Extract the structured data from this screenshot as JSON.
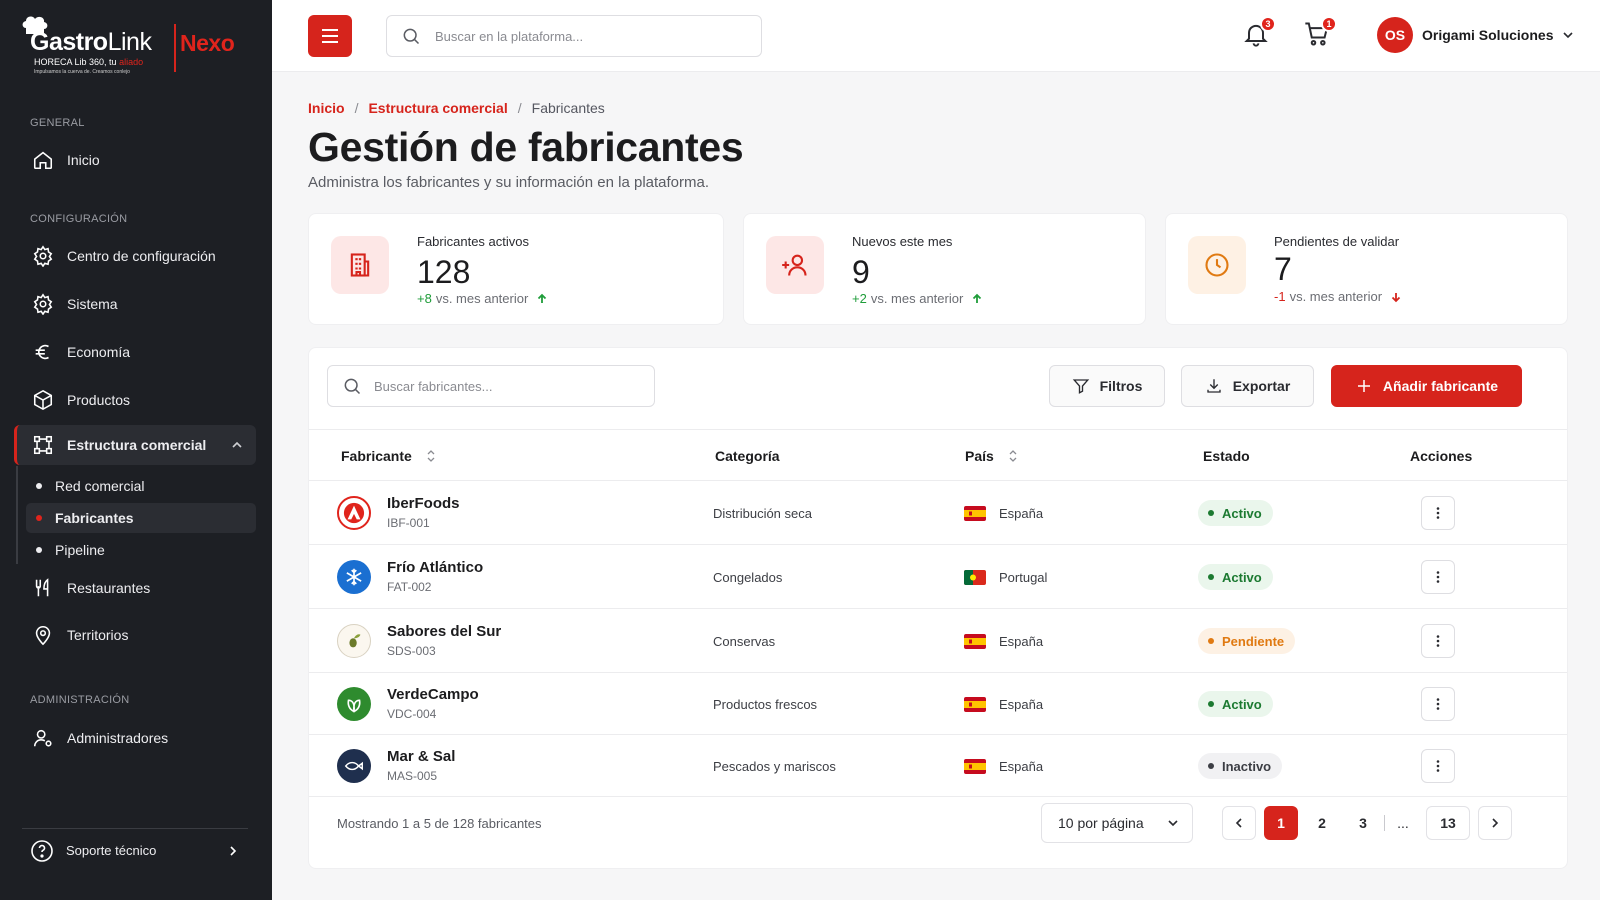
{
  "brand": {
    "name_bold": "Gastro",
    "name_light": "Link",
    "name_accent": "Nexo",
    "tagline": "HORECA Lib 360, tu",
    "tagline_accent": "aliado",
    "tagline_small": "Impulsamos la cuerva de. Creamos conlejo"
  },
  "sidebar": {
    "sections": {
      "general": "GENERAL",
      "config": "CONFIGURACIÓN",
      "admin": "ADMINISTRACIÓN"
    },
    "items": {
      "inicio": "Inicio",
      "centro": "Centro de configuración",
      "sistema": "Sistema",
      "economia": "Economía",
      "productos": "Productos",
      "estructura": "Estructura comercial",
      "restaurantes": "Restaurantes",
      "territorios": "Territorios",
      "administradores": "Administradores"
    },
    "sub_items": {
      "red": "Red comercial",
      "fabricantes": "Fabricantes",
      "pipeline": "Pipeline"
    },
    "support": "Soporte técnico"
  },
  "topbar": {
    "search_placeholder": "Buscar en la plataforma...",
    "notifications_count": "3",
    "cart_count": "1",
    "user_initials": "OS",
    "user_name": "Origami Soluciones"
  },
  "breadcrumb": {
    "home": "Inicio",
    "section": "Estructura comercial",
    "current": "Fabricantes",
    "separator": "/"
  },
  "page": {
    "title": "Gestión de fabricantes",
    "subtitle": "Administra los fabricantes y su información en la plataforma."
  },
  "stats": [
    {
      "label": "Fabricantes activos",
      "value": "128",
      "delta": "+8",
      "delta_text": "vs. mes anterior"
    },
    {
      "label": "Nuevos este mes",
      "value": "9",
      "delta": "+2",
      "delta_text": "vs. mes anterior"
    },
    {
      "label": "Pendientes de validar",
      "value": "7",
      "delta": "-1",
      "delta_text": "vs. mes anterior"
    }
  ],
  "toolbar": {
    "search_placeholder": "Buscar fabricantes...",
    "filters": "Filtros",
    "export": "Exportar",
    "add": "Añadir fabricante"
  },
  "table": {
    "columns": [
      "Fabricante",
      "Categoría",
      "País",
      "Estado",
      "Acciones"
    ],
    "rows": [
      {
        "name": "IberFoods",
        "code": "IBF-001",
        "category": "Distribución seca",
        "country": "España",
        "status": "Activo"
      },
      {
        "name": "Frío Atlántico",
        "code": "FAT-002",
        "category": "Congelados",
        "country": "Portugal",
        "status": "Activo"
      },
      {
        "name": "Sabores del Sur",
        "code": "SDS-003",
        "category": "Conservas",
        "country": "España",
        "status": "Pendiente"
      },
      {
        "name": "VerdeCampo",
        "code": "VDC-004",
        "category": "Productos frescos",
        "country": "España",
        "status": "Activo"
      },
      {
        "name": "Mar & Sal",
        "code": "MAS-005",
        "category": "Pescados y mariscos",
        "country": "España",
        "status": "Inactivo"
      }
    ]
  },
  "pagination": {
    "summary": "Mostrando 1 a 5 de 128 fabricantes",
    "per_page": "10 por página",
    "pages": [
      "1",
      "2",
      "3"
    ],
    "ellipsis": "...",
    "last": "13"
  },
  "colors": {
    "accent": "#d6241c",
    "sidebar_bg": "#1d1f24",
    "active_green": "#1c7a31",
    "pending_orange": "#e07a12"
  }
}
